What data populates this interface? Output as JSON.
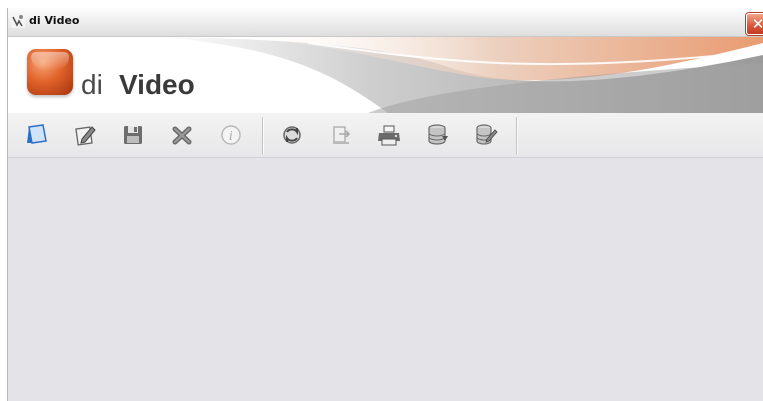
{
  "window": {
    "title": "di Video",
    "close_glyph": "✕"
  },
  "banner": {
    "logo_prefix": "di",
    "logo_name": "Video",
    "accent_color": "#e0622a"
  },
  "toolbar": {
    "group1": [
      {
        "name": "new-document-icon",
        "tooltip": "New"
      },
      {
        "name": "edit-document-icon",
        "tooltip": "Edit"
      },
      {
        "name": "save-disk-icon",
        "tooltip": "Save"
      },
      {
        "name": "delete-x-icon",
        "tooltip": "Delete"
      },
      {
        "name": "info-icon",
        "tooltip": "Info",
        "disabled": true
      }
    ],
    "group2": [
      {
        "name": "refresh-icon",
        "tooltip": "Refresh"
      },
      {
        "name": "export-icon",
        "tooltip": "Export",
        "disabled": true
      },
      {
        "name": "printer-icon",
        "tooltip": "Print"
      },
      {
        "name": "database-sync-icon",
        "tooltip": "Database"
      },
      {
        "name": "database-edit-icon",
        "tooltip": "Database edit"
      }
    ]
  }
}
